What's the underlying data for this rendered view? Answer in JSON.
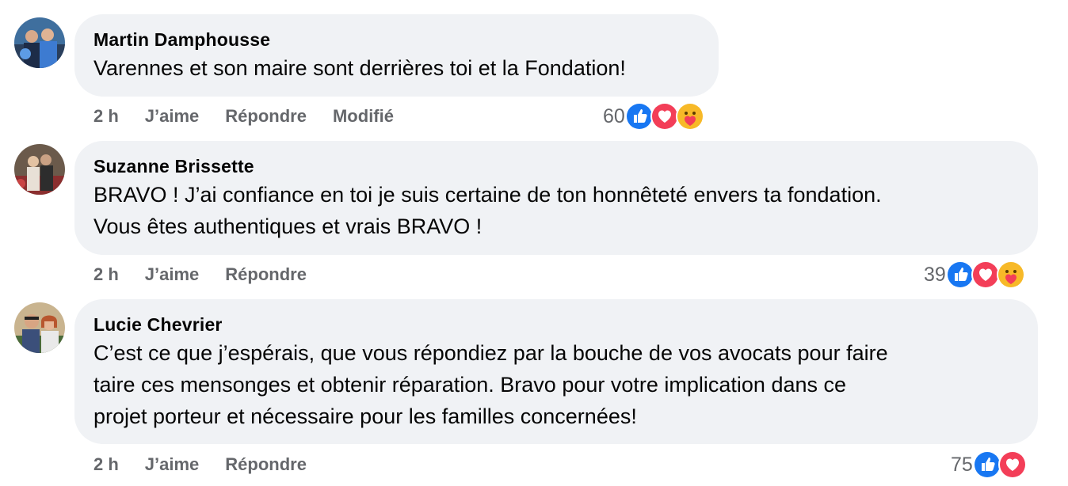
{
  "comments": [
    {
      "author": "Martin Damphousse",
      "text": "Varennes et son maire sont derrières toi et la Fondation!",
      "time": "2 h",
      "like": "J’aime",
      "reply": "Répondre",
      "edited": "Modifié",
      "reaction_count": "60",
      "reactions": [
        "like-icon",
        "love-icon",
        "care-icon"
      ]
    },
    {
      "author": "Suzanne Brissette",
      "text_lines": [
        "BRAVO ! J’ai confiance en toi je suis certaine de ton honnêteté envers ta fondation.",
        "Vous êtes authentiques et vrais BRAVO !"
      ],
      "time": "2 h",
      "like": "J’aime",
      "reply": "Répondre",
      "reaction_count": "39",
      "reactions": [
        "like-icon",
        "love-icon",
        "care-icon"
      ]
    },
    {
      "author": "Lucie Chevrier",
      "text_lines": [
        "C’est ce que j’espérais, que vous répondiez par la bouche de vos avocats pour faire",
        "taire ces mensonges et obtenir réparation. Bravo pour votre implication dans ce",
        "projet porteur et nécessaire pour les familles concernées!"
      ],
      "time": "2 h",
      "like": "J’aime",
      "reply": "Répondre",
      "reaction_count": "75",
      "reactions": [
        "like-icon",
        "love-icon"
      ]
    }
  ],
  "colors": {
    "bubble": "#f0f2f5",
    "meta_text": "#65676b",
    "like_blue": "#1877f2",
    "love_red": "#f33e58",
    "care_yellow": "#f7b928"
  }
}
